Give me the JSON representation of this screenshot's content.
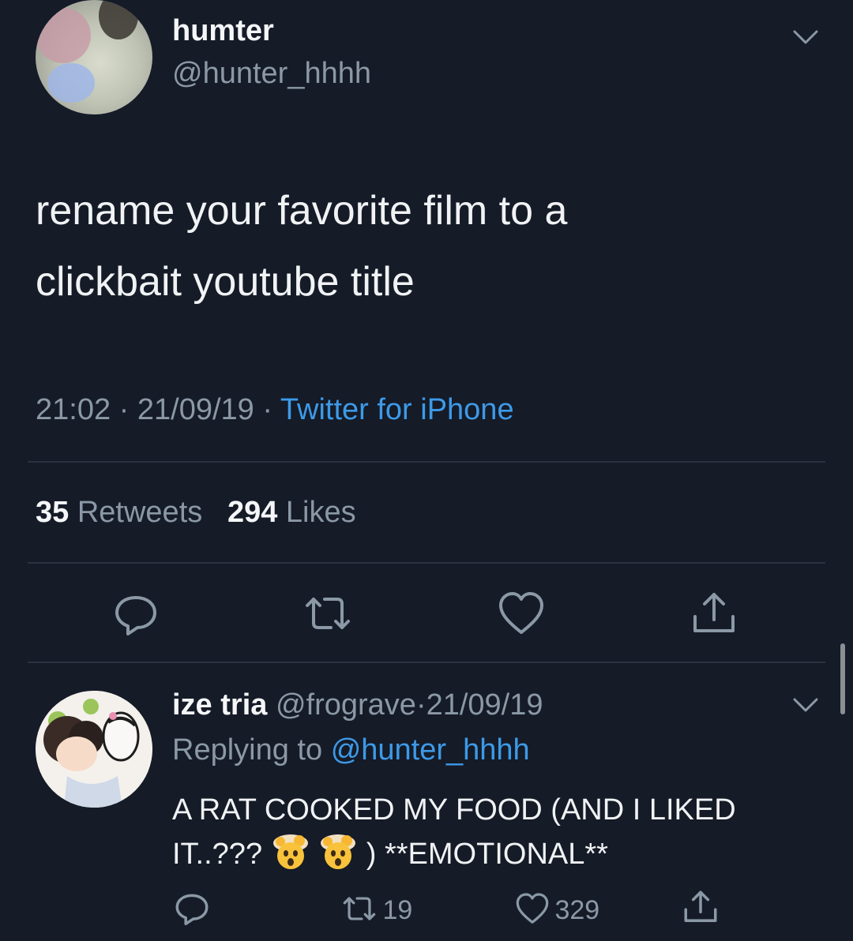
{
  "tweet": {
    "display_name": "humter",
    "handle": "@hunter_hhhh",
    "text_line1": "rename your favorite film to a",
    "text_line2": "clickbait youtube title",
    "time": "21:02",
    "date": "21/09/19",
    "separator": "·",
    "source": "Twitter for iPhone",
    "retweet_count": "35",
    "retweet_label": "Retweets",
    "like_count": "294",
    "like_label": "Likes"
  },
  "reply": {
    "display_name": "ize tria",
    "handle": "@frograve",
    "separator": "·",
    "date": "21/09/19",
    "replying_prefix": "Replying to",
    "replying_to": "@hunter_hhhh",
    "text_line1": "A RAT COOKED MY FOOD (AND I LIKED",
    "text_line2_start": "IT..???",
    "text_line2_end": ") **EMOTIONAL**",
    "retweet_count": "19",
    "like_count": "329"
  },
  "icons": {
    "reply": "reply-icon",
    "retweet": "retweet-icon",
    "like": "heart-icon",
    "share": "share-icon",
    "menu": "chevron-down-icon",
    "emoji": "exploding-head-emoji"
  },
  "colors": {
    "background": "#151b27",
    "text": "#f0f2f4",
    "secondary": "#8b98a6",
    "link": "#3d9ae8",
    "divider": "#2a3340"
  }
}
